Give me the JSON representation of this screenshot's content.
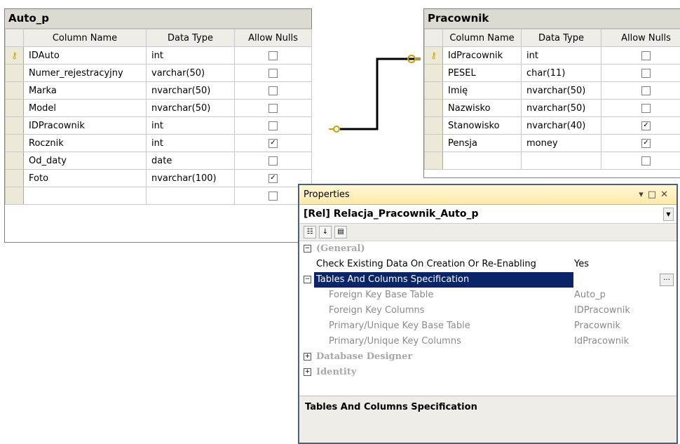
{
  "tables": {
    "auto_p": {
      "title": "Auto_p",
      "headers": {
        "name": "Column Name",
        "type": "Data Type",
        "nulls": "Allow Nulls"
      },
      "rows": [
        {
          "name": "IDAuto",
          "type": "int",
          "nulls": false,
          "pk": true
        },
        {
          "name": "Numer_rejestracyjny",
          "type": "varchar(50)",
          "nulls": false
        },
        {
          "name": "Marka",
          "type": "nvarchar(50)",
          "nulls": false
        },
        {
          "name": "Model",
          "type": "nvarchar(50)",
          "nulls": false
        },
        {
          "name": "IDPracownik",
          "type": "int",
          "nulls": false
        },
        {
          "name": "Rocznik",
          "type": "int",
          "nulls": true
        },
        {
          "name": "Od_daty",
          "type": "date",
          "nulls": false
        },
        {
          "name": "Foto",
          "type": "nvarchar(100)",
          "nulls": true
        }
      ]
    },
    "pracownik": {
      "title": "Pracownik",
      "headers": {
        "name": "Column Name",
        "type": "Data Type",
        "nulls": "Allow Nulls"
      },
      "rows": [
        {
          "name": "IdPracownik",
          "type": "int",
          "nulls": false,
          "pk": true
        },
        {
          "name": "PESEL",
          "type": "char(11)",
          "nulls": false
        },
        {
          "name": "Imię",
          "type": "nvarchar(50)",
          "nulls": false
        },
        {
          "name": "Nazwisko",
          "type": "nvarchar(50)",
          "nulls": false
        },
        {
          "name": "Stanowisko",
          "type": "nvarchar(40)",
          "nulls": true
        },
        {
          "name": "Pensja",
          "type": "money",
          "nulls": true
        }
      ]
    }
  },
  "properties": {
    "title": "Properties",
    "object": "[Rel] Relacja_Pracownik_Auto_p",
    "general": "(General)",
    "check_label": "Check Existing Data On Creation Or Re-Enabling",
    "check_value": "Yes",
    "tcs_label": "Tables And Columns Specification",
    "fk_base_label": "Foreign Key Base Table",
    "fk_base_value": "Auto_p",
    "fk_cols_label": "Foreign Key Columns",
    "fk_cols_value": "IDPracownik",
    "pk_base_label": "Primary/Unique Key Base Table",
    "pk_base_value": "Pracownik",
    "pk_cols_label": "Primary/Unique Key Columns",
    "pk_cols_value": "IdPracownik",
    "db_designer": "Database Designer",
    "identity": "Identity",
    "description_title": "Tables And Columns Specification"
  },
  "colors": {
    "selection": "#0a246a",
    "title_bar": "#ffe9a8",
    "grid_header": "#eeede7"
  }
}
